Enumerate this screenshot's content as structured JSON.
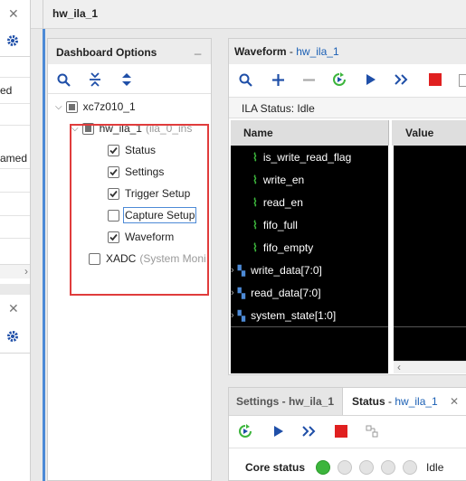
{
  "window_title": "hw_ila_1",
  "left_panel": {
    "fragments": [
      "ed",
      "amed"
    ]
  },
  "dashboard": {
    "title": "Dashboard Options",
    "minimize": "_",
    "tree": {
      "device": "xc7z010_1",
      "ila": "hw_ila_1",
      "ila_suffix": "(ila_0_ins",
      "options": [
        {
          "label": "Status",
          "checked": true
        },
        {
          "label": "Settings",
          "checked": true
        },
        {
          "label": "Trigger Setup",
          "checked": true
        },
        {
          "label": "Capture Setup",
          "checked": false
        },
        {
          "label": "Waveform",
          "checked": true
        }
      ],
      "xadc": "XADC",
      "xadc_suffix": "(System Moni"
    }
  },
  "waveform": {
    "title": "Waveform",
    "title_sep": " - ",
    "title_link": "hw_ila_1",
    "ila_status_label": "ILA Status:",
    "ila_status_value": "Idle",
    "col_name": "Name",
    "col_value": "Value",
    "signals": [
      {
        "name": "is_write_read_flag",
        "bus": false
      },
      {
        "name": "write_en",
        "bus": false
      },
      {
        "name": "read_en",
        "bus": false
      },
      {
        "name": "fifo_full",
        "bus": false
      },
      {
        "name": "fifo_empty",
        "bus": false
      },
      {
        "name": "write_data[7:0]",
        "bus": true
      },
      {
        "name": "read_data[7:0]",
        "bus": true
      },
      {
        "name": "system_state[1:0]",
        "bus": true
      }
    ]
  },
  "bottom": {
    "tab_settings": "Settings - hw_ila_1",
    "tab_status": "Status",
    "tab_status_sep": " - ",
    "tab_status_link": "hw_ila_1",
    "core_status_label": "Core status",
    "core_status_value": "Idle"
  },
  "colors": {
    "accent": "#1a5fb4",
    "panel_border": "#4d8ad6",
    "highlight_box": "#e03c3c",
    "led_active": "#3cb53c",
    "stop_red": "#e02020",
    "run_blue": "#1f4fa8"
  }
}
